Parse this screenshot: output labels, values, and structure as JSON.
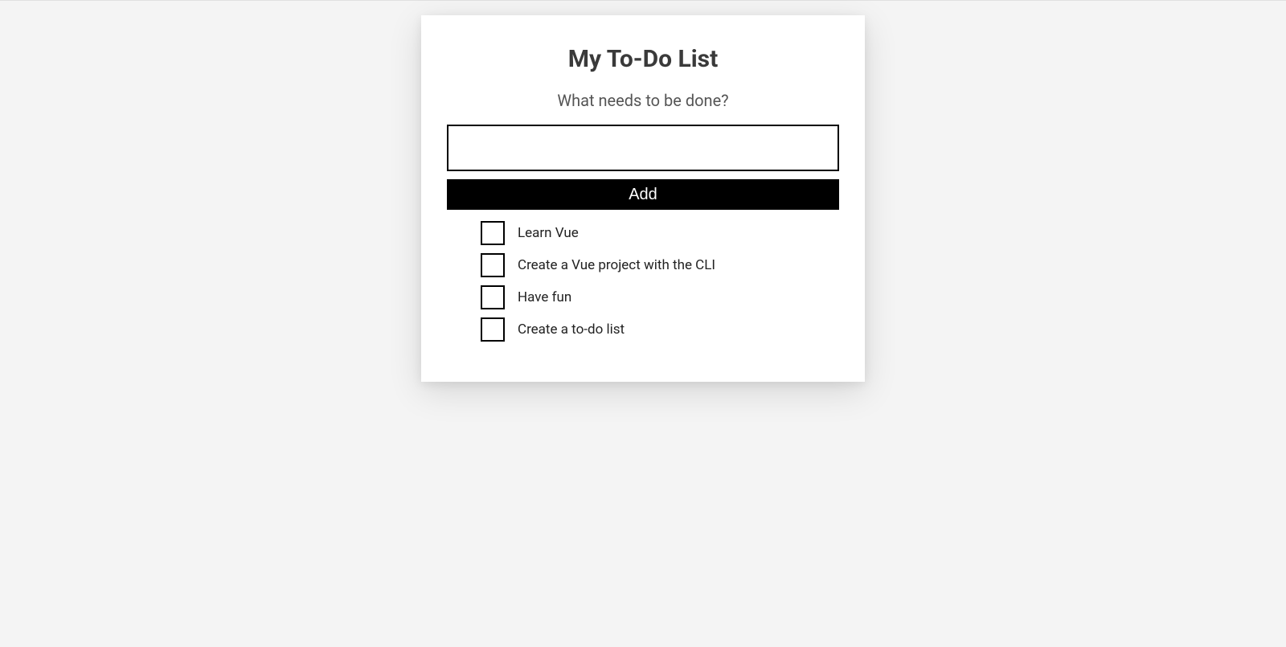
{
  "header": {
    "title": "My To-Do List"
  },
  "form": {
    "prompt_label": "What needs to be done?",
    "input_value": "",
    "add_button_label": "Add"
  },
  "todos": [
    {
      "label": "Learn Vue",
      "done": false
    },
    {
      "label": "Create a Vue project with the CLI",
      "done": false
    },
    {
      "label": "Have fun",
      "done": false
    },
    {
      "label": "Create a to-do list",
      "done": false
    }
  ]
}
